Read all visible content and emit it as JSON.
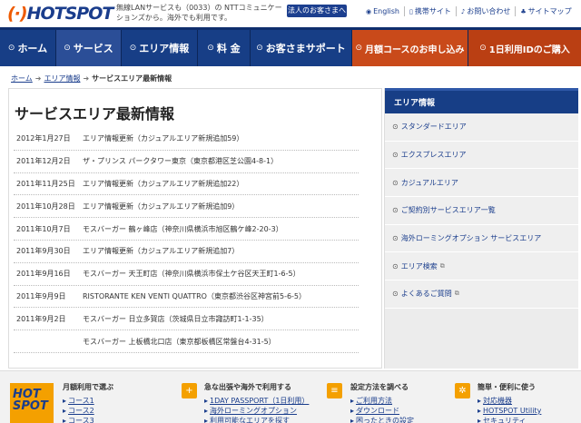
{
  "header": {
    "logo_text": "HOTSPOT",
    "tagline": "無線LANサービスも（0033）の NTTコミュニケーションズから。海外でも利用です。",
    "biz_button": "法人のお客さまへ",
    "links": [
      {
        "label": "English",
        "icon": "globe-icon"
      },
      {
        "label": "携帯サイト",
        "icon": "mobile-icon"
      },
      {
        "label": "お問い合わせ",
        "icon": "phone-icon"
      },
      {
        "label": "サイトマップ",
        "icon": "sitemap-icon"
      }
    ]
  },
  "nav": {
    "items": [
      {
        "label": "ホーム"
      },
      {
        "label": "サービス"
      },
      {
        "label": "エリア情報"
      },
      {
        "label": "料 金"
      },
      {
        "label": "お客さまサポート"
      },
      {
        "label": "月額コースのお申し込み"
      },
      {
        "label": "1日利用IDのご購入"
      }
    ]
  },
  "breadcrumb": {
    "items": [
      "ホーム",
      "エリア情報",
      "サービスエリア最新情報"
    ]
  },
  "main": {
    "title": "サービスエリア最新情報",
    "rows": [
      {
        "date": "2012年1月27日",
        "text": "エリア情報更新（カジュアルエリア新規追加59）"
      },
      {
        "date": "2011年12月2日",
        "text": "ザ・プリンス パークタワー東京（東京都港区芝公園4-8-1）"
      },
      {
        "date": "2011年11月25日",
        "text": "エリア情報更新（カジュアルエリア新規追加22）"
      },
      {
        "date": "2011年10月28日",
        "text": "エリア情報更新（カジュアルエリア新規追加9）"
      },
      {
        "date": "2011年10月7日",
        "text": "モスバーガー 鶴ヶ峰店（神奈川県横浜市旭区鶴ケ峰2-20-3）"
      },
      {
        "date": "2011年9月30日",
        "text": "エリア情報更新（カジュアルエリア新規追加7）"
      },
      {
        "date": "2011年9月16日",
        "text": "モスバーガー 天王町店（神奈川県横浜市保土ケ谷区天王町1-6-5）"
      },
      {
        "date": "2011年9月9日",
        "text": "RISTORANTE KEN VENTI QUATTRO（東京都渋谷区神宮前5-6-5）"
      },
      {
        "date": "2011年9月2日",
        "text": "モスバーガー 日立多賀店（茨城県日立市諏訪町1-1-35）"
      },
      {
        "date": "",
        "text": "モスバーガー 上板橋北口店（東京都板橋区常盤台4-31-5）"
      }
    ]
  },
  "sidebar": {
    "title": "エリア情報",
    "items": [
      {
        "label": "スタンダードエリア",
        "ext": false
      },
      {
        "label": "エクスプレスエリア",
        "ext": false
      },
      {
        "label": "カジュアルエリア",
        "ext": false
      },
      {
        "label": "ご契約別サービスエリア一覧",
        "ext": false
      },
      {
        "label": "海外ローミングオプション サービスエリア",
        "ext": false
      },
      {
        "label": "エリア検索",
        "ext": true
      },
      {
        "label": "よくあるご質問",
        "ext": true
      }
    ]
  },
  "footer": {
    "logo_text": "HOT SPOT",
    "columns": [
      {
        "title": "月額利用で選ぶ",
        "links": [
          "コース1",
          "コース2",
          "コース3"
        ]
      },
      {
        "title": "急な出張や海外で利用する",
        "links": [
          "1DAY PASSPORT（1日利用）",
          "海外ローミングオプション",
          "利用可能なエリアを探す"
        ]
      },
      {
        "title": "設定方法を調べる",
        "links": [
          "ご利用方法",
          "ダウンロード",
          "困ったときの設定"
        ]
      },
      {
        "title": "簡単・便利に使う",
        "links": [
          "対応機器",
          "HOTSPOT Utility",
          "セキュリティ"
        ]
      }
    ]
  },
  "colors": {
    "brand_blue": "#173e86",
    "accent_orange": "#c94a1a",
    "logo_orange": "#f4a000"
  }
}
